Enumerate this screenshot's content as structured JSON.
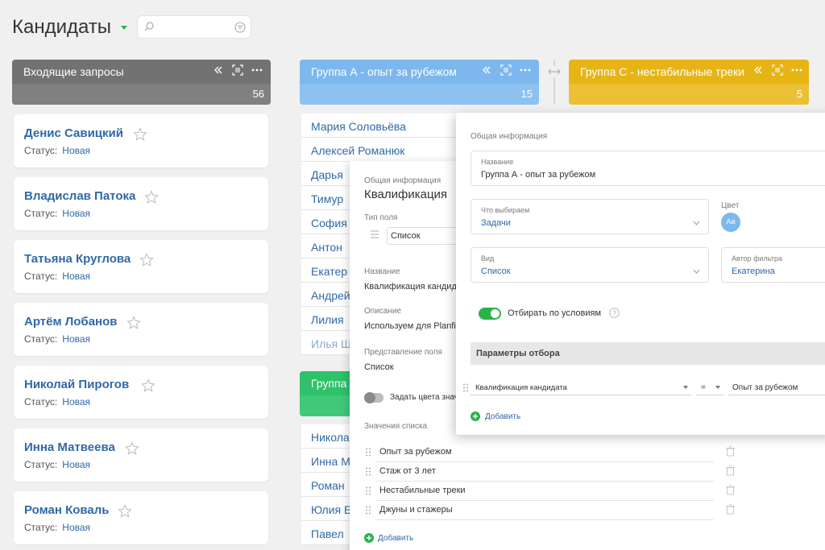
{
  "header": {
    "title": "Кандидаты"
  },
  "columns": [
    {
      "title": "Входящие запросы",
      "count": "56",
      "color": "#727272"
    },
    {
      "title": "Группа А - опыт за рубежом",
      "count": "15",
      "color": "#7cb8ee"
    },
    {
      "title": "Группа С - нестабильные треки",
      "count": "5",
      "color": "#e7b416"
    },
    {
      "title": "Группа",
      "color": "#2ec26a"
    }
  ],
  "incoming_cards": [
    {
      "name": "Денис Савицкий",
      "status_label": "Статус:",
      "status": "Новая"
    },
    {
      "name": "Владислав Патока",
      "status_label": "Статус:",
      "status": "Новая"
    },
    {
      "name": "Татьяна Круглова",
      "status_label": "Статус:",
      "status": "Новая"
    },
    {
      "name": "Артём Лобанов",
      "status_label": "Статус:",
      "status": "Новая"
    },
    {
      "name": "Николай Пирогов",
      "status_label": "Статус:",
      "status": "Новая"
    },
    {
      "name": "Инна Матвеева",
      "status_label": "Статус:",
      "status": "Новая"
    },
    {
      "name": "Роман Коваль",
      "status_label": "Статус:",
      "status": "Новая"
    }
  ],
  "group_a_rows": [
    "Мария Соловьёва",
    "Алексей Романюк",
    "Дарья",
    "Тимур",
    "София",
    "Антон",
    "Екатер",
    "Андрей",
    "Лилия",
    "Илья Ш"
  ],
  "group_b_rows": [
    "Никола",
    "Инна М",
    "Роман",
    "Юлия Б",
    "Павел"
  ],
  "field_panel": {
    "section": "Общая информация",
    "title": "Квалификация",
    "type_label": "Тип поля",
    "type_value": "Список",
    "name_label": "Название",
    "name_value": "Квалификация кандид",
    "desc_label": "Описание",
    "desc_value": "Используем для Planfix",
    "view_label": "Представление поля",
    "view_value": "Список",
    "colors_toggle": "Задать цвета знач",
    "values_label": "Значения списка",
    "values": [
      "Опыт за рубежом",
      "Стаж от 3 лет",
      "Нестабильные треки",
      "Джуны и стажеры"
    ],
    "add": "Добавить"
  },
  "filter_panel": {
    "section": "Общая информация",
    "name_label": "Название",
    "name_value": "Группа А - опыт за рубежом",
    "what_label": "Что выбираем",
    "what_value": "Задачи",
    "color_label": "Цвет",
    "color_badge": "Aa",
    "view_label": "Вид",
    "view_value": "Список",
    "author_label": "Автор фильтра",
    "author_value": "Екатерина",
    "toggle_label": "Отбирать по условиям",
    "params_header": "Параметры отбора",
    "cond_field": "Квалификация кандидата",
    "cond_op": "=",
    "cond_value": "Опыт за рубежом",
    "add": "Добавить"
  }
}
